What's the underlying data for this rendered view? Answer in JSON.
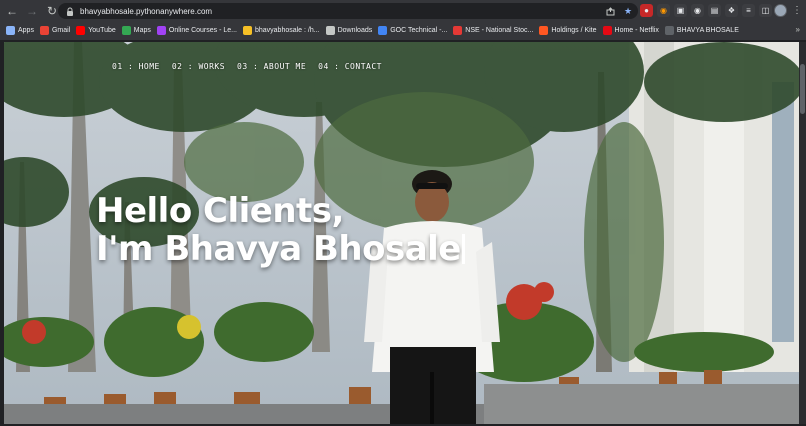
{
  "browser": {
    "url_domain": "bhavyabhosale.pythonanywhere.com",
    "url_path": "",
    "bookmarks": [
      {
        "label": "Apps",
        "icon": "apps-grid-icon",
        "color": "#8ab4f8"
      },
      {
        "label": "Gmail",
        "icon": "gmail-icon",
        "color": "#ea4335"
      },
      {
        "label": "YouTube",
        "icon": "youtube-icon",
        "color": "#ff0000"
      },
      {
        "label": "Maps",
        "icon": "maps-icon",
        "color": "#34a853"
      },
      {
        "label": "Online Courses - Le...",
        "icon": "courses-icon",
        "color": "#a142f4"
      },
      {
        "label": "bhavyabhosale : /h...",
        "icon": "python-icon",
        "color": "#f6c026"
      },
      {
        "label": "Downloads",
        "icon": "download-icon",
        "color": "#c4c7c5"
      },
      {
        "label": "GOC Technical -...",
        "icon": "goc-icon",
        "color": "#4285f4"
      },
      {
        "label": "NSE - National Stoc...",
        "icon": "nse-icon",
        "color": "#e53935"
      },
      {
        "label": "Holdings / Kite",
        "icon": "kite-icon",
        "color": "#ff5722"
      },
      {
        "label": "Home - Netflix",
        "icon": "netflix-icon",
        "color": "#e50914"
      },
      {
        "label": "BHAVYA BHOSALE",
        "icon": "site-favicon-icon",
        "color": "#5f6368"
      }
    ]
  },
  "site": {
    "nav": [
      {
        "label": "01 : HOME"
      },
      {
        "label": "02 : WORKS"
      },
      {
        "label": "03 : ABOUT ME"
      },
      {
        "label": "04 : CONTACT"
      }
    ],
    "hero_line1": "Hello Clients,",
    "hero_line2": "I'm Bhavya Bhosale"
  },
  "colors": {
    "chrome_bg": "#35363a",
    "omnibox_bg": "#202124",
    "hero_text": "#ffffff"
  }
}
